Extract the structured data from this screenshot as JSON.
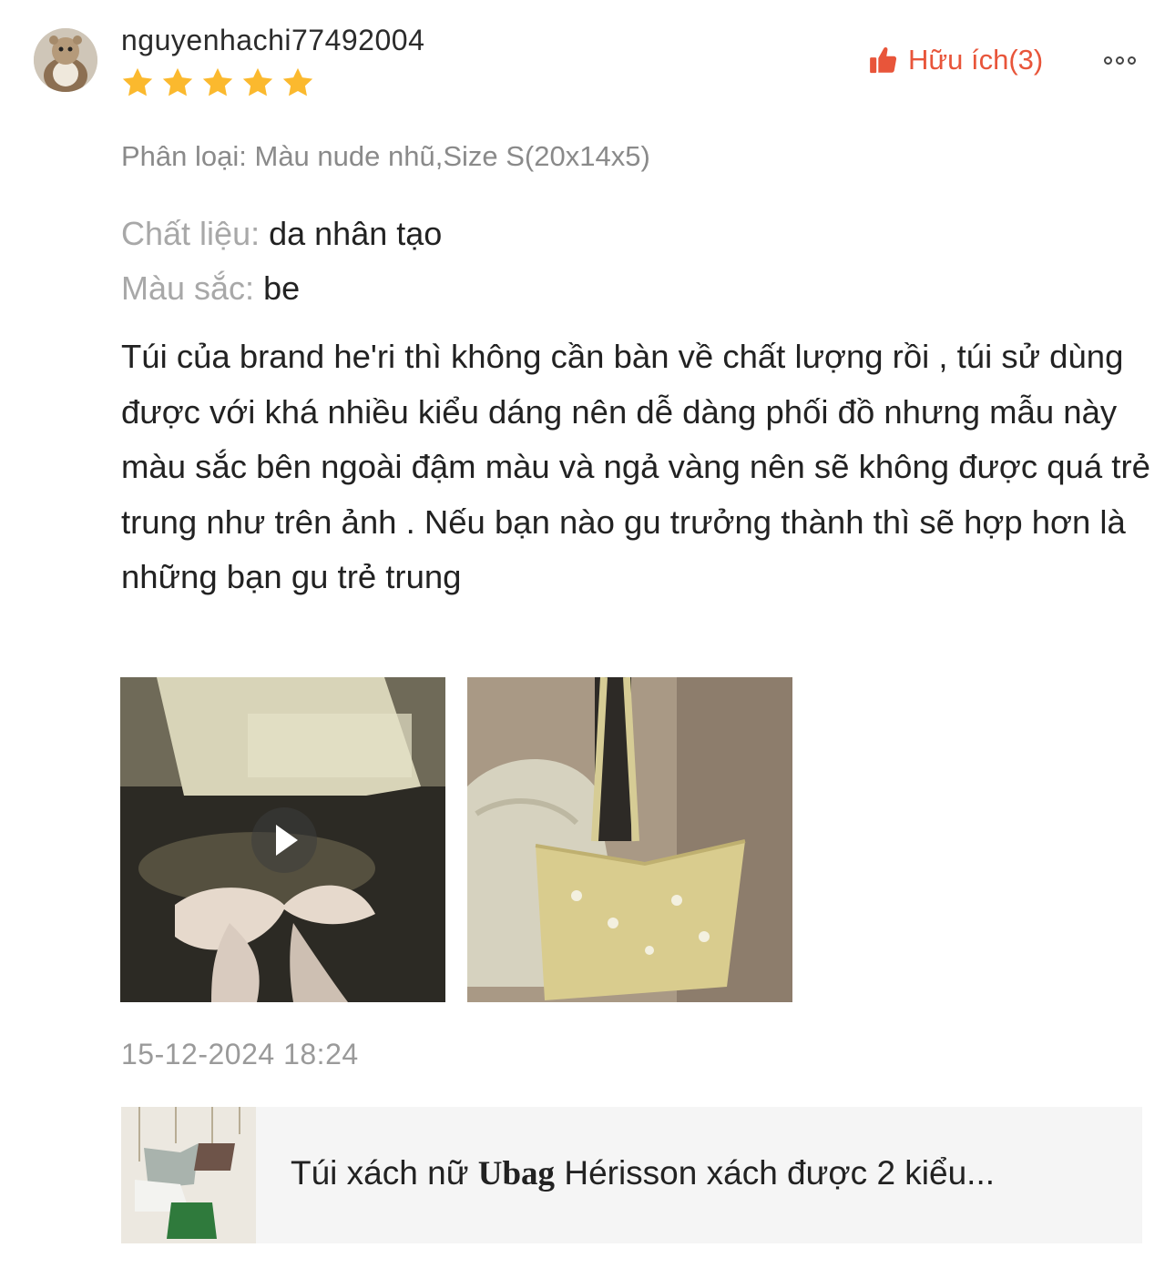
{
  "review": {
    "username": "nguyenhachi77492004",
    "rating": 5,
    "helpful": {
      "label": "Hữu ích",
      "count_text": "(3)",
      "icon": "thumbs-up-icon",
      "color": "#e8553a"
    },
    "more_icon": "more-dots-icon",
    "variant": "Phân loại: Màu nude nhũ,Size S(20x14x5)",
    "attributes": [
      {
        "key": "Chất liệu:",
        "value": "da nhân tạo"
      },
      {
        "key": "Màu sắc:",
        "value": "be"
      }
    ],
    "text": "Túi của brand he'ri thì không cần bàn về chất lượng rồi , túi sử dùng được với khá nhiều kiểu dáng nên dễ dàng phối đồ nhưng mẫu này màu sắc bên ngoài đậm màu và ngả vàng nên sẽ không được quá trẻ trung như trên ảnh . Nếu bạn nào gu trưởng thành thì sẽ hợp hơn là những bạn gu trẻ trung",
    "media": [
      {
        "type": "video",
        "icon": "play-icon"
      },
      {
        "type": "image"
      }
    ],
    "date": "15-12-2024 18:24"
  },
  "product": {
    "title_prefix": "Túi xách nữ ",
    "title_brand": "Ubag",
    "title_suffix": " Hérisson xách được 2 kiểu..."
  },
  "colors": {
    "star": "#fbb92e",
    "accent": "#e8553a",
    "muted": "#9a9a9a"
  }
}
